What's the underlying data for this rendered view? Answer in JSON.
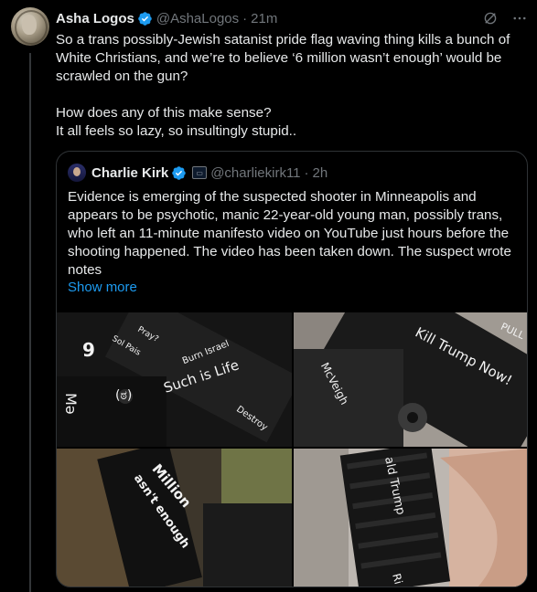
{
  "tweet": {
    "author_name": "Asha Logos",
    "author_handle": "@AshaLogos",
    "time": "21m",
    "text_line1": "So a trans possibly-Jewish satanist pride flag waving thing kills a bunch of White Christians, and we’re to believe ‘6 million wasn’t enough’ would be scrawled on the gun?",
    "text_line2": "How does any of this make sense?\nIt all feels so lazy, so insultingly stupid..",
    "icons": [
      "grok-icon",
      "more-icon",
      "verified-badge-icon"
    ],
    "colors": {
      "verified": "#1d9bf0",
      "muted": "#71767b",
      "text": "#e7e9ea",
      "link": "#1d9bf0"
    }
  },
  "quote": {
    "author_name": "Charlie Kirk",
    "author_handle": "@charliekirk11",
    "time": "2h",
    "affiliation_badge": "affiliation-icon",
    "text": "Evidence is emerging of the suspected shooter in Minneapolis and appears to be psychotic, manic 22-year-old young man, possibly trans, who left an 11-minute manifesto video on YouTube just hours before the shooting happened. The video has been taken down. The suspect wrote notes",
    "show_more": "Show more",
    "photos": [
      {
        "alt": "photo-1",
        "scrawl": [
          "Such is Life",
          "Burn Israel",
          "Destroy",
          "Sol Pais",
          "Pray?"
        ]
      },
      {
        "alt": "photo-2",
        "scrawl": [
          "Kill Trump Now!",
          "McVeigh",
          "PULL"
        ]
      },
      {
        "alt": "photo-3",
        "scrawl": [
          "Million",
          "wasn't enough"
        ]
      },
      {
        "alt": "photo-4",
        "scrawl": [
          "ald Trump",
          "Ri"
        ]
      }
    ]
  }
}
